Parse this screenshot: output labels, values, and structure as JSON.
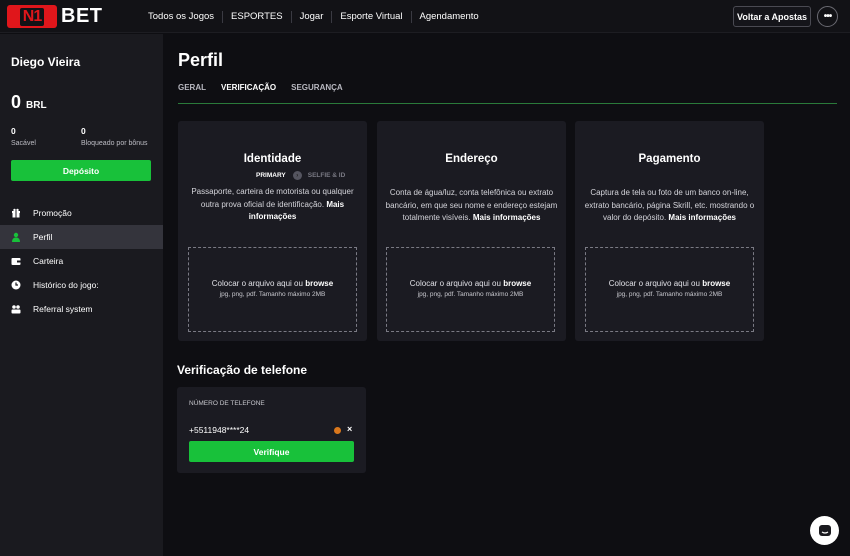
{
  "brand": {
    "logo_left": "N1",
    "logo_right": "BET",
    "accent": "#e0161b",
    "green": "#18c13a"
  },
  "nav": {
    "items": [
      "Todos os Jogos",
      "ESPORTES",
      "Jogar",
      "Esporte Virtual",
      "Agendamento"
    ],
    "voltar_label": "Voltar a Apostas",
    "more_icon": "more-icon"
  },
  "sidebar": {
    "user_name": "Diego Vieira",
    "balance": "0",
    "currency": "BRL",
    "sacavel_value": "0",
    "sacavel_label": "Sacável",
    "bloqueado_value": "0",
    "bloqueado_label": "Bloqueado por bônus",
    "deposit_label": "Depósito",
    "menu": [
      {
        "label": "Promoção",
        "icon": "gift-icon",
        "active": false
      },
      {
        "label": "Perfil",
        "icon": "user-icon",
        "active": true
      },
      {
        "label": "Carteira",
        "icon": "wallet-icon",
        "active": false
      },
      {
        "label": "Histórico do jogo:",
        "icon": "clock-icon",
        "active": false
      },
      {
        "label": "Referral system",
        "icon": "referral-icon",
        "active": false
      }
    ]
  },
  "main": {
    "title": "Perfil",
    "tabs": [
      "GERAL",
      "VERIFICAÇÃO",
      "SEGURANÇA"
    ],
    "active_tab": "VERIFICAÇÃO",
    "cards": [
      {
        "title": "Identidade",
        "tag_primary": "PRIMARY",
        "tag_secondary": "SELFIE & ID",
        "desc": "Passaporte, carteira de motorista ou qualquer outra prova oficial de identificação.",
        "more": "Mais informações",
        "dz_text": "Colocar o arquivo aqui ou",
        "dz_browse": "browse",
        "dz_hint": "jpg, png, pdf. Tamanho máximo 2MB"
      },
      {
        "title": "Endereço",
        "desc": "Conta de água/luz, conta telefônica ou extrato bancário, em que seu nome e endereço estejam totalmente visíveis.",
        "more": "Mais informações",
        "dz_text": "Colocar o arquivo aqui ou",
        "dz_browse": "browse",
        "dz_hint": "jpg, png, pdf. Tamanho máximo 2MB"
      },
      {
        "title": "Pagamento",
        "desc": "Captura de tela ou foto de um banco on-line, extrato bancário, página Skrill, etc. mostrando o valor do depósito.",
        "more": "Mais informações",
        "dz_text": "Colocar o arquivo aqui ou",
        "dz_browse": "browse",
        "dz_hint": "jpg, png, pdf. Tamanho máximo 2MB"
      }
    ],
    "phone": {
      "title": "Verificação de telefone",
      "label": "NÚMERO DE TELEFONE",
      "number": "+5511948****24",
      "status_color": "#d9771c",
      "clear_icon": "×",
      "verify_label": "Verifique"
    }
  }
}
